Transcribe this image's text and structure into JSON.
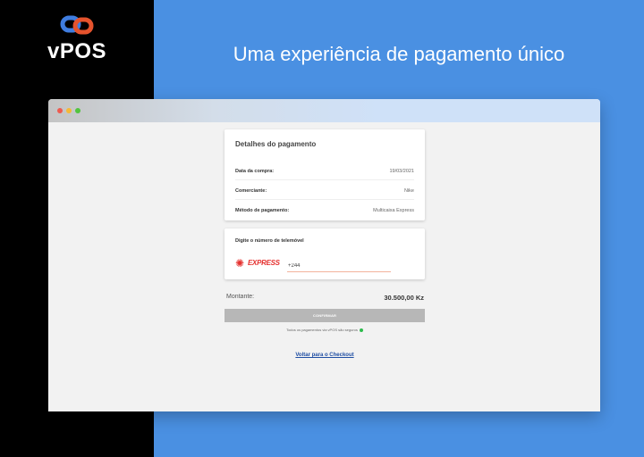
{
  "brand": {
    "name": "vPOS",
    "logo_icon": "link-chain-icon",
    "logo_colors": [
      "#3f7de0",
      "#e5532d"
    ]
  },
  "headline": "Uma experiência de pagamento único",
  "payment_details": {
    "title": "Detalhes do pagamento",
    "rows": [
      {
        "label": "Data da compra:",
        "value": "19/03/2021"
      },
      {
        "label": "Comerciante:",
        "value": "Nike"
      },
      {
        "label": "Método de pagamento:",
        "value": "Multicaixa Express"
      }
    ]
  },
  "phone": {
    "title": "Digite o número de telemóvel",
    "provider_logo_text": "EXPRESS",
    "input_value": "+244"
  },
  "amount": {
    "label": "Montante:",
    "value": "30.500,00 Kz"
  },
  "confirm_label": "CONFIRMAR",
  "secure_note": "Todos os pagamentos via vPOS são seguros",
  "back_link": "Voltar para o Checkout",
  "colors": {
    "background_blue": "#4a90e2",
    "sidebar": "#000000",
    "button_disabled": "#b7b7b7",
    "link": "#1f4ea3",
    "express_red": "#e5312f"
  }
}
